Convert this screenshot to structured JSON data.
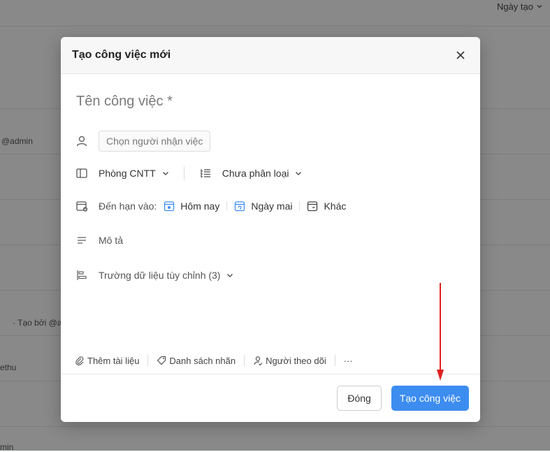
{
  "background": {
    "sort_label": "Ngày tạo",
    "snippets": [
      "@admin",
      "· Tạo bởi @a",
      "ethu",
      "min"
    ],
    "accent": "#3d8df0"
  },
  "modal": {
    "title": "Tạo công việc mới",
    "name_placeholder": "Tên công việc *",
    "assignee_placeholder": "Chọn người nhận việc",
    "department": "Phòng CNTT",
    "category": "Chưa phân loại",
    "due_label": "Đến hạn vào:",
    "due_options": [
      "Hôm nay",
      "Ngày mai",
      "Khác"
    ],
    "description_label": "Mô tả",
    "custom_fields_label": "Trường dữ liệu tùy chỉnh (3)",
    "toolbar": {
      "attach": "Thêm tài liệu",
      "tags": "Danh sách nhãn",
      "followers": "Người theo dõi",
      "more": "···"
    },
    "footer": {
      "cancel": "Đóng",
      "create": "Tạo công việc"
    }
  },
  "annotation": {
    "color": "#e02020"
  }
}
